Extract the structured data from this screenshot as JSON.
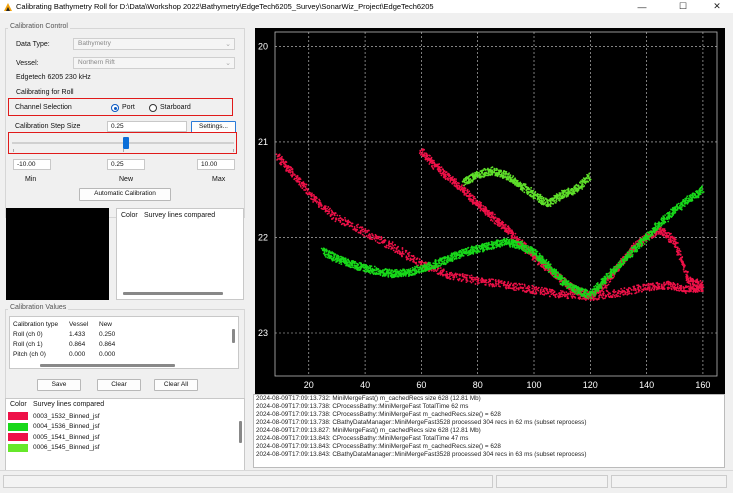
{
  "window": {
    "title": "Calibrating Bathymetry Roll for D:\\Data\\Workshop 2022\\Bathymetry\\EdgeTech6205_Survey\\SonarWiz_Project\\EdgeTech6205",
    "minimize": "—",
    "maximize": "☐",
    "close": "✕"
  },
  "calibration_control": {
    "group_title": "Calibration Control",
    "data_type_label": "Data Type:",
    "data_type_value": "Bathymetry",
    "vessel_label": "Vessel:",
    "vessel_value": "Northern Rift",
    "sonar_label": "Edgetech 6205 230 kHz",
    "calibrating_for": "Calibrating for Roll",
    "channel_selection_label": "Channel Selection",
    "port_label": "Port",
    "starboard_label": "Starboard",
    "port_selected": true,
    "step_size_label": "Calibration Step Size",
    "step_size_value": "0.25",
    "settings_button": "Settings...",
    "slider": {
      "min": -10.0,
      "max": 10.0,
      "value": 0.25
    },
    "min_value": "-10.00",
    "new_value": "0.25",
    "max_value": "10.00",
    "min_label": "Min",
    "new_label": "New",
    "max_label": "Max",
    "auto_button": "Automatic Calibration"
  },
  "survey_lines_header": {
    "color_col": "Color",
    "name_col": "Survey lines compared"
  },
  "calibration_values": {
    "group_title": "Calibration Values",
    "headers": [
      "Calibration type",
      "Vessel",
      "New"
    ],
    "rows": [
      [
        "Roll (ch 0)",
        "1.433",
        "0.250"
      ],
      [
        "Roll (ch 1)",
        "0.864",
        "0.864"
      ],
      [
        "Pitch (ch 0)",
        "0.000",
        "0.000"
      ]
    ],
    "save_button": "Save",
    "clear_button": "Clear",
    "clear_all_button": "Clear All"
  },
  "survey_lines": {
    "color_col": "Color",
    "name_col": "Survey lines compared",
    "items": [
      {
        "name": "0003_1532_Binned_jsf",
        "color": "#ee1148"
      },
      {
        "name": "0004_1536_Binned_jsf",
        "color": "#18d81a"
      },
      {
        "name": "0005_1541_Binned_jsf",
        "color": "#ee1148"
      },
      {
        "name": "0006_1545_Binned_jsf",
        "color": "#66e82a"
      }
    ]
  },
  "chart_data": {
    "type": "scatter",
    "xlim": [
      8,
      165
    ],
    "ylim": [
      23.45,
      19.85
    ],
    "x_ticks": [
      20,
      40,
      60,
      80,
      100,
      120,
      140,
      160
    ],
    "x_tick_labels": [
      "20",
      "40",
      "60",
      "80",
      "100",
      "120",
      "140",
      "160"
    ],
    "y_ticks": [
      20,
      21,
      22,
      23
    ],
    "y_tick_labels": [
      "20",
      "21",
      "22",
      "23"
    ],
    "grid": true,
    "inverted_y": true,
    "background": "#000000",
    "series": [
      {
        "color": "#ee1148",
        "x": [
          9,
          15,
          22,
          30,
          40,
          50,
          60,
          70,
          80,
          90,
          100,
          110,
          120,
          130,
          140,
          148,
          155,
          160
        ],
        "y": [
          21.15,
          21.35,
          21.6,
          21.8,
          21.95,
          22.1,
          22.28,
          22.4,
          22.45,
          22.5,
          22.55,
          22.6,
          22.62,
          22.58,
          22.52,
          22.5,
          22.55,
          22.52
        ]
      },
      {
        "color": "#ee1148",
        "x": [
          60,
          65,
          70,
          75,
          80,
          85,
          90,
          95,
          100,
          105,
          110,
          115,
          120,
          125,
          130,
          135,
          140,
          145,
          150,
          155,
          160
        ],
        "y": [
          21.1,
          21.25,
          21.38,
          21.5,
          21.65,
          21.78,
          21.9,
          22.05,
          22.2,
          22.32,
          22.45,
          22.55,
          22.62,
          22.5,
          22.3,
          22.12,
          22.0,
          21.92,
          22.05,
          22.45,
          22.5
        ]
      },
      {
        "color": "#18d81a",
        "x": [
          25,
          30,
          35,
          40,
          45,
          50,
          55,
          60,
          65,
          70,
          75,
          80,
          85,
          90,
          95,
          100,
          105,
          110,
          115,
          120,
          125,
          130,
          135,
          140,
          145,
          150,
          155,
          160
        ],
        "y": [
          22.15,
          22.22,
          22.28,
          22.32,
          22.36,
          22.38,
          22.37,
          22.33,
          22.28,
          22.22,
          22.16,
          22.12,
          22.08,
          22.05,
          22.08,
          22.15,
          22.3,
          22.45,
          22.55,
          22.6,
          22.45,
          22.3,
          22.15,
          22.0,
          21.85,
          21.72,
          21.6,
          21.5
        ]
      },
      {
        "color": "#5fe02a",
        "x": [
          75,
          80,
          85,
          90,
          95,
          100,
          105,
          110,
          115,
          120
        ],
        "y": [
          21.42,
          21.35,
          21.3,
          21.35,
          21.45,
          21.55,
          21.65,
          21.55,
          21.5,
          21.35
        ]
      }
    ]
  },
  "log": {
    "lines": [
      "2024-08-09T17:09:13.732: MiniMergeFast() m_cachedRecs size 628 (12.81 Mb)",
      "2024-08-09T17:09:13.738: CProcessBathy::MiniMergeFast TotalTime 62 ms",
      "2024-08-09T17:09:13.738: CProcessBathy::MiniMergeFast m_cachedRecs.size() = 628",
      "2024-08-09T17:09:13.738: CBathyDataManager::MiniMergeFast3528 processed 304 recs in 62 ms (subset reprocess)",
      "2024-08-09T17:09:13.827: MiniMergeFast() m_cachedRecs size 628 (12.81 Mb)",
      "2024-08-09T17:09:13.843: CProcessBathy::MiniMergeFast TotalTime 47 ms",
      "2024-08-09T17:09:13.843: CProcessBathy::MiniMergeFast m_cachedRecs.size() = 628",
      "2024-08-09T17:09:13.843: CBathyDataManager::MiniMergeFast3528 processed 304 recs in 63 ms (subset reprocess)"
    ]
  }
}
